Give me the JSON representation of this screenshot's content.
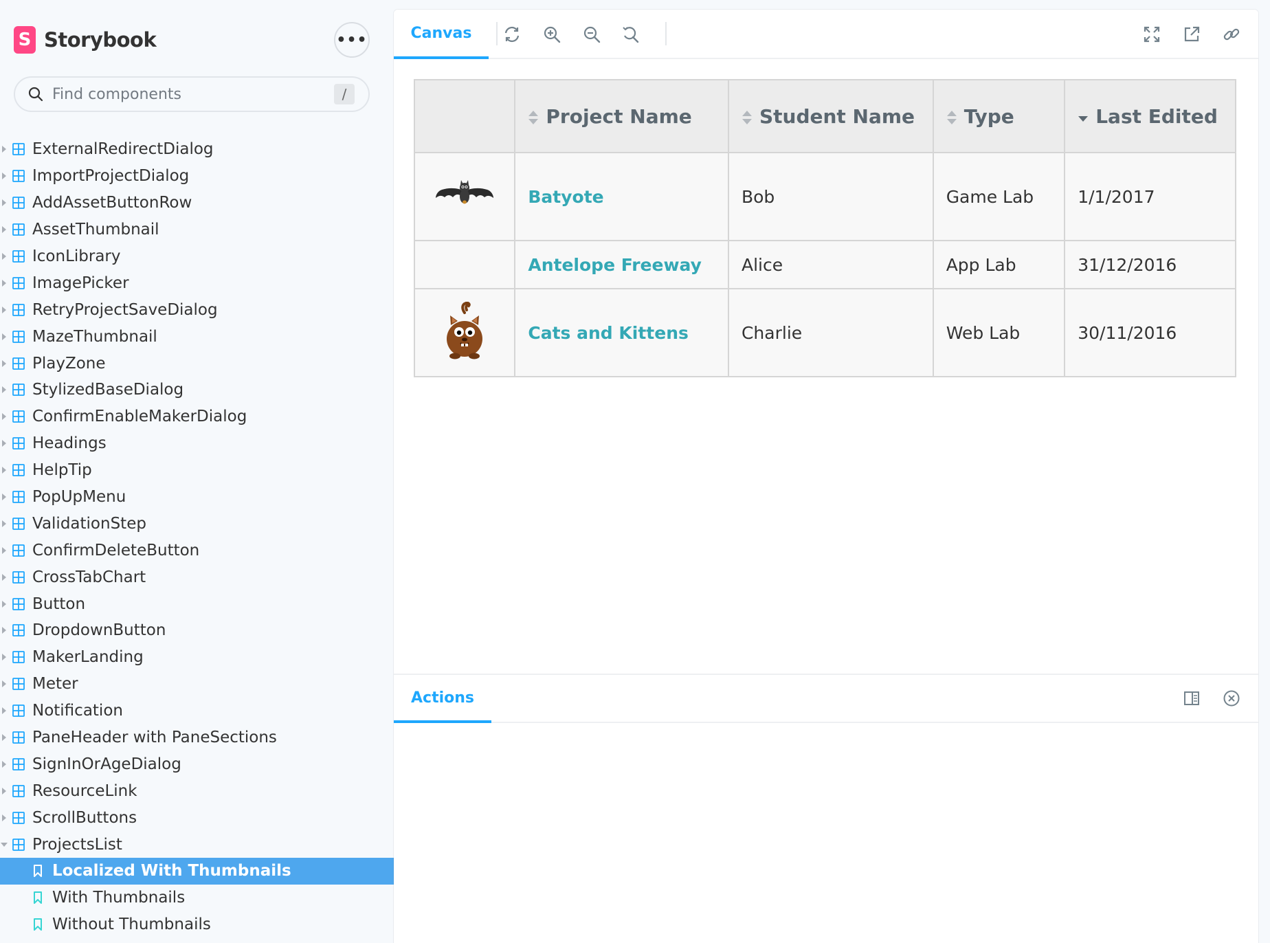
{
  "brand": {
    "logo_letter": "S",
    "name": "Storybook"
  },
  "sidebar_menu": {
    "label": "•••"
  },
  "search": {
    "placeholder": "Find components",
    "shortcut": "/"
  },
  "tree": {
    "components": [
      {
        "label": "ExternalRedirectDialog"
      },
      {
        "label": "ImportProjectDialog"
      },
      {
        "label": "AddAssetButtonRow"
      },
      {
        "label": "AssetThumbnail"
      },
      {
        "label": "IconLibrary"
      },
      {
        "label": "ImagePicker"
      },
      {
        "label": "RetryProjectSaveDialog"
      },
      {
        "label": "MazeThumbnail"
      },
      {
        "label": "PlayZone"
      },
      {
        "label": "StylizedBaseDialog"
      },
      {
        "label": "ConfirmEnableMakerDialog"
      },
      {
        "label": "Headings"
      },
      {
        "label": "HelpTip"
      },
      {
        "label": "PopUpMenu"
      },
      {
        "label": "ValidationStep"
      },
      {
        "label": "ConfirmDeleteButton"
      },
      {
        "label": "CrossTabChart"
      },
      {
        "label": "Button"
      },
      {
        "label": "DropdownButton"
      },
      {
        "label": "MakerLanding"
      },
      {
        "label": "Meter"
      },
      {
        "label": "Notification"
      },
      {
        "label": "PaneHeader with PaneSections"
      },
      {
        "label": "SignInOrAgeDialog"
      },
      {
        "label": "ResourceLink"
      },
      {
        "label": "ScrollButtons"
      }
    ],
    "expanded_component": "ProjectsList",
    "stories": [
      {
        "label": "Localized With Thumbnails",
        "active": true
      },
      {
        "label": "With Thumbnails",
        "active": false
      },
      {
        "label": "Without Thumbnails",
        "active": false
      }
    ]
  },
  "toolbar": {
    "canvas_tab": "Canvas",
    "icons": [
      "reload-icon",
      "zoom-in-icon",
      "zoom-out-icon",
      "zoom-reset-icon",
      "fullscreen-icon",
      "open-new-tab-icon",
      "copy-link-icon"
    ]
  },
  "table": {
    "columns": [
      "",
      "Project Name",
      "Student Name",
      "Type",
      "Last Edited"
    ],
    "sort": {
      "column": "Last Edited",
      "direction": "descending"
    },
    "rows": [
      {
        "thumbnail": "bat",
        "project": "Batyote",
        "student": "Bob",
        "type": "Game Lab",
        "edited": "1/1/2017"
      },
      {
        "thumbnail": "",
        "project": "Antelope Freeway",
        "student": "Alice",
        "type": "App Lab",
        "edited": "31/12/2016"
      },
      {
        "thumbnail": "cat",
        "project": "Cats and Kittens",
        "student": "Charlie",
        "type": "Web Lab",
        "edited": "30/11/2016"
      }
    ]
  },
  "actions": {
    "tab": "Actions",
    "icons": [
      "panel-orientation-icon",
      "close-panel-icon"
    ]
  },
  "colors": {
    "accent": "#1ea7fd",
    "active_story_bg": "#4ea7ee",
    "link": "#34a8b5",
    "brand": "#ff4785"
  }
}
